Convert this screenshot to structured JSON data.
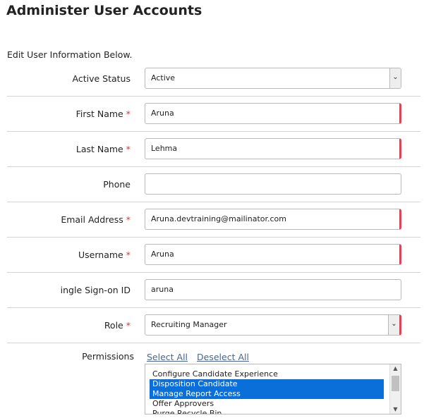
{
  "page": {
    "title": "Administer User Accounts",
    "intro": "Edit User Information Below."
  },
  "fields": {
    "active_status": {
      "label": "Active Status",
      "value": "Active",
      "required": false
    },
    "first_name": {
      "label": "First Name",
      "value": "Aruna",
      "required": true
    },
    "last_name": {
      "label": "Last Name",
      "value": "Lehma",
      "required": true
    },
    "phone": {
      "label": "Phone",
      "value": "",
      "required": false
    },
    "email": {
      "label": "Email Address",
      "value": "Aruna.devtraining@mailinator.com",
      "required": true
    },
    "username": {
      "label": "Username",
      "value": "Aruna",
      "required": true
    },
    "sso_id": {
      "label": "ingle Sign-on ID",
      "value": "aruna",
      "required": false
    },
    "role": {
      "label": "Role",
      "value": "Recruiting Manager",
      "required": true
    }
  },
  "required_marker": "*",
  "permissions": {
    "label": "Permissions",
    "select_all": "Select All",
    "deselect_all": "Deselect All",
    "items": [
      {
        "label": "Configure Candidate Experience",
        "selected": false
      },
      {
        "label": "Disposition Candidate",
        "selected": true
      },
      {
        "label": "Manage Report Access",
        "selected": true
      },
      {
        "label": "Offer Approvers",
        "selected": false
      },
      {
        "label": "Purge Recycle Bin",
        "selected": false
      }
    ]
  },
  "colors": {
    "required_marker": "#d0393f",
    "required_border": "#d4495a",
    "selection": "#0a6fd8",
    "link": "#49678a"
  },
  "icons": {
    "dropdown": "chevron-down-icon",
    "scroll_up": "scroll-up-icon",
    "scroll_down": "scroll-down-icon"
  }
}
